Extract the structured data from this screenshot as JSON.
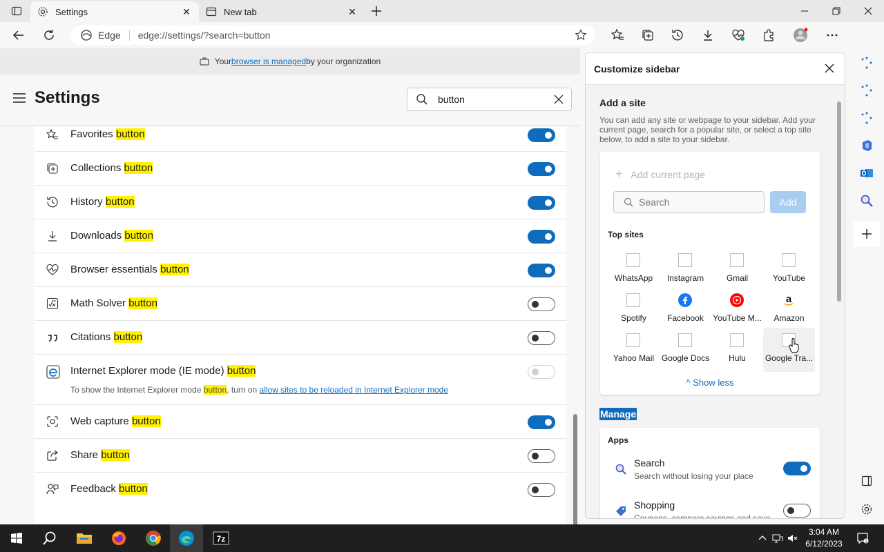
{
  "tabs": [
    {
      "title": "Settings"
    },
    {
      "title": "New tab"
    }
  ],
  "address": {
    "site_label": "Edge",
    "url": "edge://settings/?search=button"
  },
  "banner": {
    "prefix": "Your ",
    "link": "browser is managed",
    "suffix": " by your organization"
  },
  "settings": {
    "title": "Settings",
    "search_value": "button"
  },
  "rows": [
    {
      "label": "Favorites ",
      "hl": "button",
      "icon": "favorites-icon",
      "state": "on"
    },
    {
      "label": "Collections ",
      "hl": "button",
      "icon": "collections-icon",
      "state": "on"
    },
    {
      "label": "History ",
      "hl": "button",
      "icon": "history-icon",
      "state": "on"
    },
    {
      "label": "Downloads ",
      "hl": "button",
      "icon": "downloads-icon",
      "state": "on"
    },
    {
      "label": "Browser essentials ",
      "hl": "button",
      "icon": "heartbeat-icon",
      "state": "on"
    },
    {
      "label": "Math Solver ",
      "hl": "button",
      "icon": "math-solver-icon",
      "state": "off"
    },
    {
      "label": " Citations ",
      "hl": "button",
      "icon": "quote-icon",
      "state": "off"
    },
    {
      "label": "Internet Explorer mode (IE mode) ",
      "hl": "button",
      "icon": "ie-icon",
      "state": "disabled",
      "sub_prefix": "To show the Internet Explorer mode ",
      "sub_hl": "button",
      "sub_mid": ", turn on ",
      "sub_link": "allow sites to be reloaded in Internet Explorer mode"
    },
    {
      "label": "Web capture ",
      "hl": "button",
      "icon": "web-capture-icon",
      "state": "on"
    },
    {
      "label": "Share ",
      "hl": "button",
      "icon": "share-icon",
      "state": "off"
    },
    {
      "label": "Feedback ",
      "hl": "button",
      "icon": "feedback-icon",
      "state": "off"
    }
  ],
  "panel": {
    "title": "Customize sidebar",
    "add_site_heading": "Add a site",
    "add_site_desc": "You can add any site or webpage to your sidebar. Add your current page, search for a popular site, or select a top site below, to add a site to your sidebar.",
    "add_current_page": "Add current page",
    "search_placeholder": "Search",
    "add_button": "Add",
    "top_sites_heading": "Top sites",
    "top_sites": [
      {
        "name": "WhatsApp",
        "logo": "blank"
      },
      {
        "name": "Instagram",
        "logo": "blank"
      },
      {
        "name": "Gmail",
        "logo": "blank"
      },
      {
        "name": "YouTube",
        "logo": "blank"
      },
      {
        "name": "Spotify",
        "logo": "blank"
      },
      {
        "name": "Facebook",
        "logo": "facebook"
      },
      {
        "name": "YouTube M...",
        "logo": "youtube-music"
      },
      {
        "name": "Amazon",
        "logo": "amazon"
      },
      {
        "name": "Yahoo Mail",
        "logo": "blank"
      },
      {
        "name": "Google Docs",
        "logo": "blank"
      },
      {
        "name": "Hulu",
        "logo": "blank"
      },
      {
        "name": "Google Tra...",
        "logo": "blank"
      }
    ],
    "show_less": "Show less",
    "manage_heading": "Manage",
    "apps_heading": "Apps",
    "apps": [
      {
        "name": "Search",
        "desc": "Search without losing your place",
        "state": "on"
      },
      {
        "name": "Shopping",
        "desc": "Coupons, compare savings and save",
        "state": "off"
      }
    ]
  },
  "taskbar": {
    "time": "3:04 AM",
    "date": "6/12/2023"
  },
  "colors": {
    "accent": "#0f6cbd",
    "highlight": "#fff100"
  }
}
